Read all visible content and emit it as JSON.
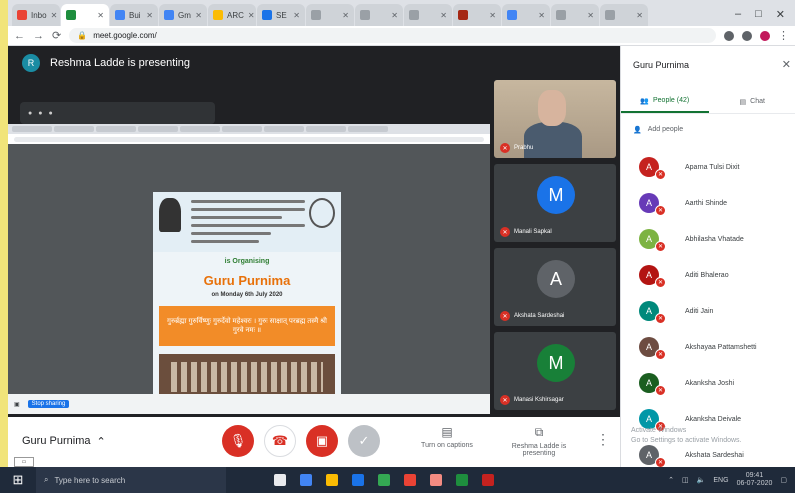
{
  "browser": {
    "tabs": [
      {
        "label": "Inbo",
        "color": "#ea4335",
        "active": false
      },
      {
        "label": "",
        "color": "#1e8e3e",
        "active": true
      },
      {
        "label": "Bui",
        "color": "#4285f4",
        "active": false
      },
      {
        "label": "Gm",
        "color": "#4285f4",
        "active": false
      },
      {
        "label": "ARC",
        "color": "#fbbc04",
        "active": false
      },
      {
        "label": "SE",
        "color": "#1a73e8",
        "active": false
      },
      {
        "label": "",
        "color": "#9aa0a6",
        "active": false
      },
      {
        "label": "",
        "color": "#9aa0a6",
        "active": false
      },
      {
        "label": "",
        "color": "#9aa0a6",
        "active": false
      },
      {
        "label": "",
        "color": "#a52714",
        "active": false
      },
      {
        "label": "",
        "color": "#4285f4",
        "active": false
      },
      {
        "label": "",
        "color": "#9aa0a6",
        "active": false
      },
      {
        "label": "",
        "color": "#9aa0a6",
        "active": false
      }
    ],
    "url": "meet.google.com/",
    "window_controls": [
      "–",
      "□",
      "✕"
    ]
  },
  "meet": {
    "presenter_initial": "R",
    "presenter_banner": "Reshma Ladde is presenting",
    "meeting_name": "Guru Purnima",
    "poster": {
      "organising": "is Organising",
      "title": "Guru Purnima",
      "date": "on Monday 6th July 2020",
      "mantra": "गुरुर्ब्रह्मा गुरुर्विष्णुः गुरुर्देवो महेश्वरः । गुरुः साक्षात् परब्रह्म तस्मै श्री गुरवे नमः ॥"
    },
    "shared_bottom_stop": "Stop sharing",
    "tiles": [
      {
        "name": "Prabhu",
        "initial": "",
        "color": "",
        "camera": true
      },
      {
        "name": "Manali Sapkal",
        "initial": "M",
        "color": "#1a73e8",
        "camera": false
      },
      {
        "name": "Akshata Sardeshai",
        "initial": "A",
        "color": "#5f6368",
        "camera": false
      },
      {
        "name": "Manasi Kshirsagar",
        "initial": "M",
        "color": "#188038",
        "camera": false
      }
    ],
    "controls": {
      "mic_icon": "mic-off-icon",
      "hangup_icon": "call-end-icon",
      "camera_icon": "camera-off-icon",
      "cc_icon": "check-icon",
      "captions_label": "Turn on captions",
      "present_label": "Reshma Ladde is presenting",
      "more_icon": "more-vert-icon"
    }
  },
  "panel": {
    "title": "Guru Purnima",
    "tab_people": "People (42)",
    "tab_chat": "Chat",
    "add_people": "Add people",
    "participants": [
      {
        "initial": "A",
        "name": "Aparna Tulsi Dixit",
        "color": "#c5221f"
      },
      {
        "initial": "A",
        "name": "Aarthi Shinde",
        "color": "#673ab7"
      },
      {
        "initial": "A",
        "name": "Abhilasha Vhatade",
        "color": "#7cb342"
      },
      {
        "initial": "A",
        "name": "Aditi Bhalerao",
        "color": "#b31412"
      },
      {
        "initial": "A",
        "name": "Aditi Jain",
        "color": "#00897b"
      },
      {
        "initial": "A",
        "name": "Akshayaa Pattamshetti",
        "color": "#6d4c41"
      },
      {
        "initial": "A",
        "name": "Akanksha Joshi",
        "color": "#1b5e20"
      },
      {
        "initial": "A",
        "name": "Akanksha Deivale",
        "color": "#0097a7"
      },
      {
        "initial": "A",
        "name": "Akshata Sardeshai",
        "color": "#5f6368"
      }
    ],
    "watermark_1": "Activate Windows",
    "watermark_2": "Go to Settings to activate Windows."
  },
  "taskbar": {
    "search_placeholder": "Type here to search",
    "time": "09:41",
    "date": "06-07-2020",
    "tray_lang": "ENG",
    "apps": [
      "#e8eaed",
      "#4285f4",
      "#fbbc04",
      "#1a73e8",
      "#34a853",
      "#ea4335",
      "#f28b82",
      "#1e8e3e",
      "#c5221f"
    ]
  }
}
